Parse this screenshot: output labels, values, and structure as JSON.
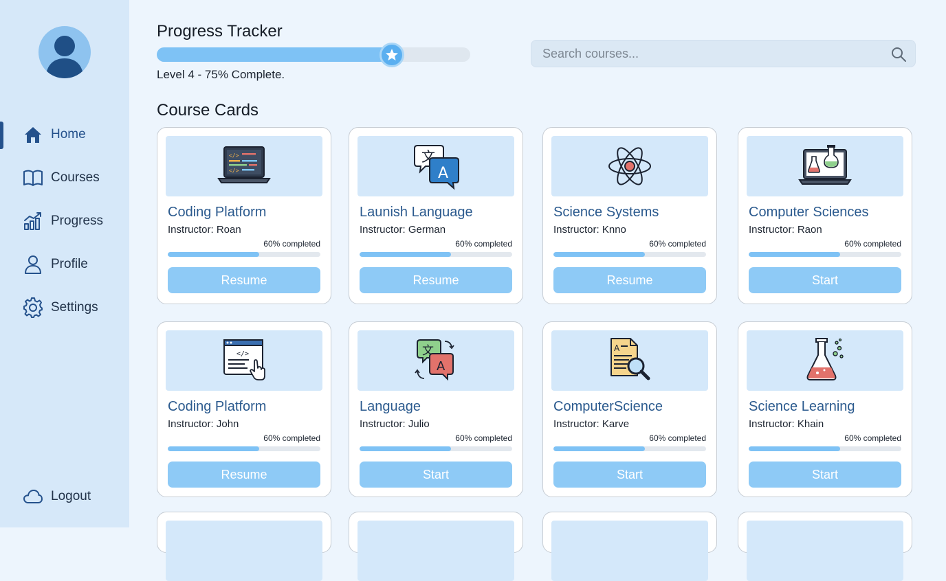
{
  "sidebar": {
    "items": [
      {
        "label": "Home",
        "icon": "home-icon",
        "active": true
      },
      {
        "label": "Courses",
        "icon": "book-icon"
      },
      {
        "label": "Progress",
        "icon": "chart-icon"
      },
      {
        "label": "Profile",
        "icon": "person-icon"
      },
      {
        "label": "Settings",
        "icon": "gear-icon"
      }
    ],
    "logout": {
      "label": "Logout",
      "icon": "cloud-icon"
    }
  },
  "header": {
    "title": "Progress Tracker",
    "progress_percent": 75,
    "progress_text": "Level 4 - 75% Complete."
  },
  "search": {
    "placeholder": "Search courses...",
    "value": ""
  },
  "section_title": "Course Cards",
  "courses": [
    {
      "title": "Coding Platform",
      "instructor": "Instructor: Roan",
      "percent_label": "60% completed",
      "percent": 60,
      "button": "Resume",
      "icon": "code-laptop-icon"
    },
    {
      "title": "Launish Language",
      "instructor": "Instructor: German",
      "percent_label": "60% completed",
      "percent": 60,
      "button": "Resume",
      "icon": "translate-icon"
    },
    {
      "title": "Science Systems",
      "instructor": "Instructor: Knno",
      "percent_label": "60% completed",
      "percent": 60,
      "button": "Resume",
      "icon": "atom-icon"
    },
    {
      "title": "Computer Sciences",
      "instructor": "Instructor: Raon",
      "percent_label": "60% completed",
      "percent": 60,
      "button": "Start",
      "icon": "lab-laptop-icon"
    },
    {
      "title": "Coding Platform",
      "instructor": "Instructor: John",
      "percent_label": "60% completed",
      "percent": 60,
      "button": "Resume",
      "icon": "code-window-icon"
    },
    {
      "title": "Language",
      "instructor": "Instructor: Julio",
      "percent_label": "60% completed",
      "percent": 60,
      "button": "Start",
      "icon": "translate-arrows-icon"
    },
    {
      "title": "ComputerScience",
      "instructor": "Instructor: Karve",
      "percent_label": "60% completed",
      "percent": 60,
      "button": "Start",
      "icon": "document-search-icon"
    },
    {
      "title": "Science Learning",
      "instructor": "Instructor: Khain",
      "percent_label": "60% completed",
      "percent": 60,
      "button": "Start",
      "icon": "flask-icon"
    }
  ],
  "colors": {
    "accent": "#7ec2f5",
    "button": "#8ecaf6",
    "card_title": "#2b5a8e",
    "sidebar_bg": "#d6e8f9",
    "page_bg": "#edf5fd"
  }
}
